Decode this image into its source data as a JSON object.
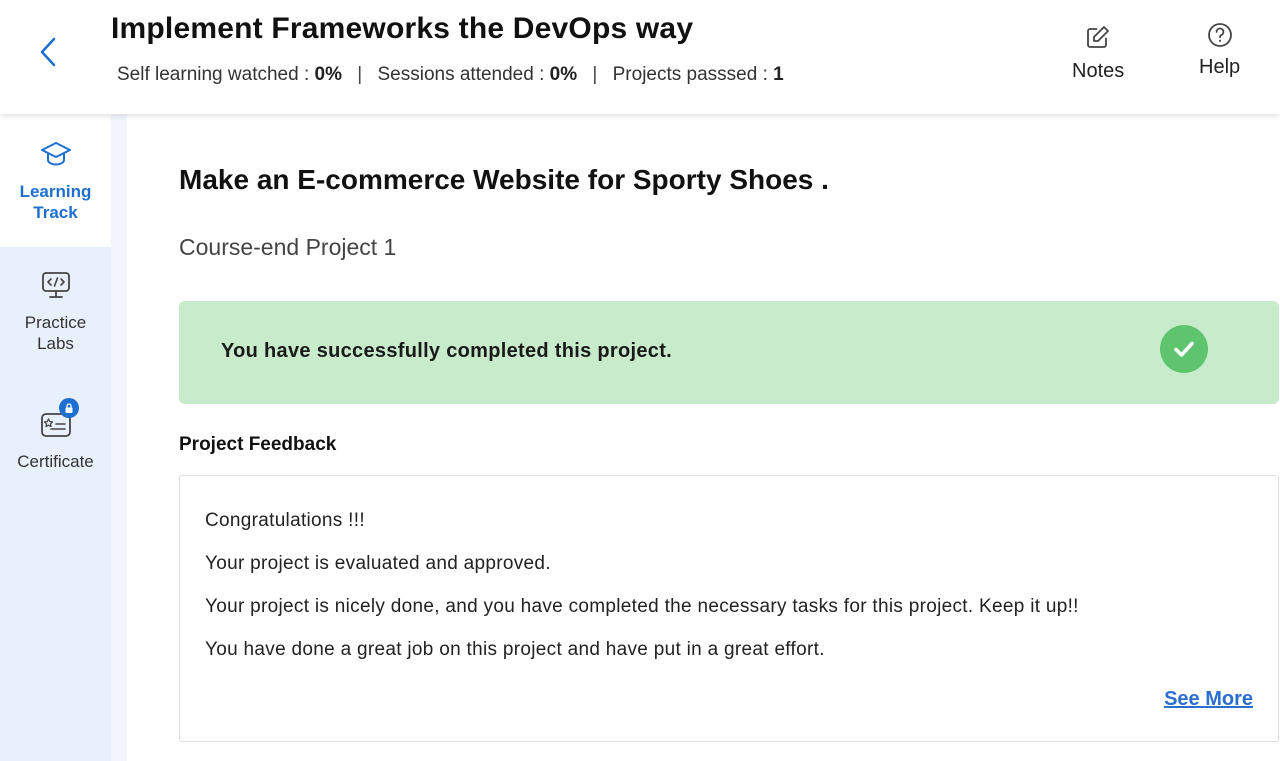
{
  "header": {
    "title": "Implement Frameworks the DevOps way",
    "stats": {
      "self_learning_label": "Self learning watched : ",
      "self_learning_value": "0%",
      "sessions_label": "Sessions attended : ",
      "sessions_value": "0%",
      "projects_label": "Projects passsed : ",
      "projects_value": "1",
      "separator": "|"
    },
    "notes_label": "Notes",
    "help_label": "Help"
  },
  "sidebar": {
    "items": [
      {
        "label": "Learning Track",
        "icon": "graduation-cap-icon",
        "active": true
      },
      {
        "label": "Practice Labs",
        "icon": "code-monitor-icon",
        "active": false
      },
      {
        "label": "Certificate",
        "icon": "certificate-lock-icon",
        "active": false
      }
    ]
  },
  "main": {
    "project_title": "Make an E-commerce Website for Sporty Shoes .",
    "project_subtitle": "Course-end Project 1",
    "success_message": "You have successfully completed this project.",
    "feedback_heading": "Project Feedback",
    "feedback_lines": [
      "Congratulations !!!",
      "Your project is evaluated and approved.",
      "Your project is nicely done, and you have completed the necessary tasks for this project. Keep it up!!",
      "You have done a great job on this project and have put in a great effort."
    ],
    "see_more_label": "See More"
  },
  "colors": {
    "accent": "#1e6fd0",
    "success_bg": "#c8ebcc",
    "success_check": "#5ec46d",
    "sidebar_bg": "#e8f0fb"
  }
}
